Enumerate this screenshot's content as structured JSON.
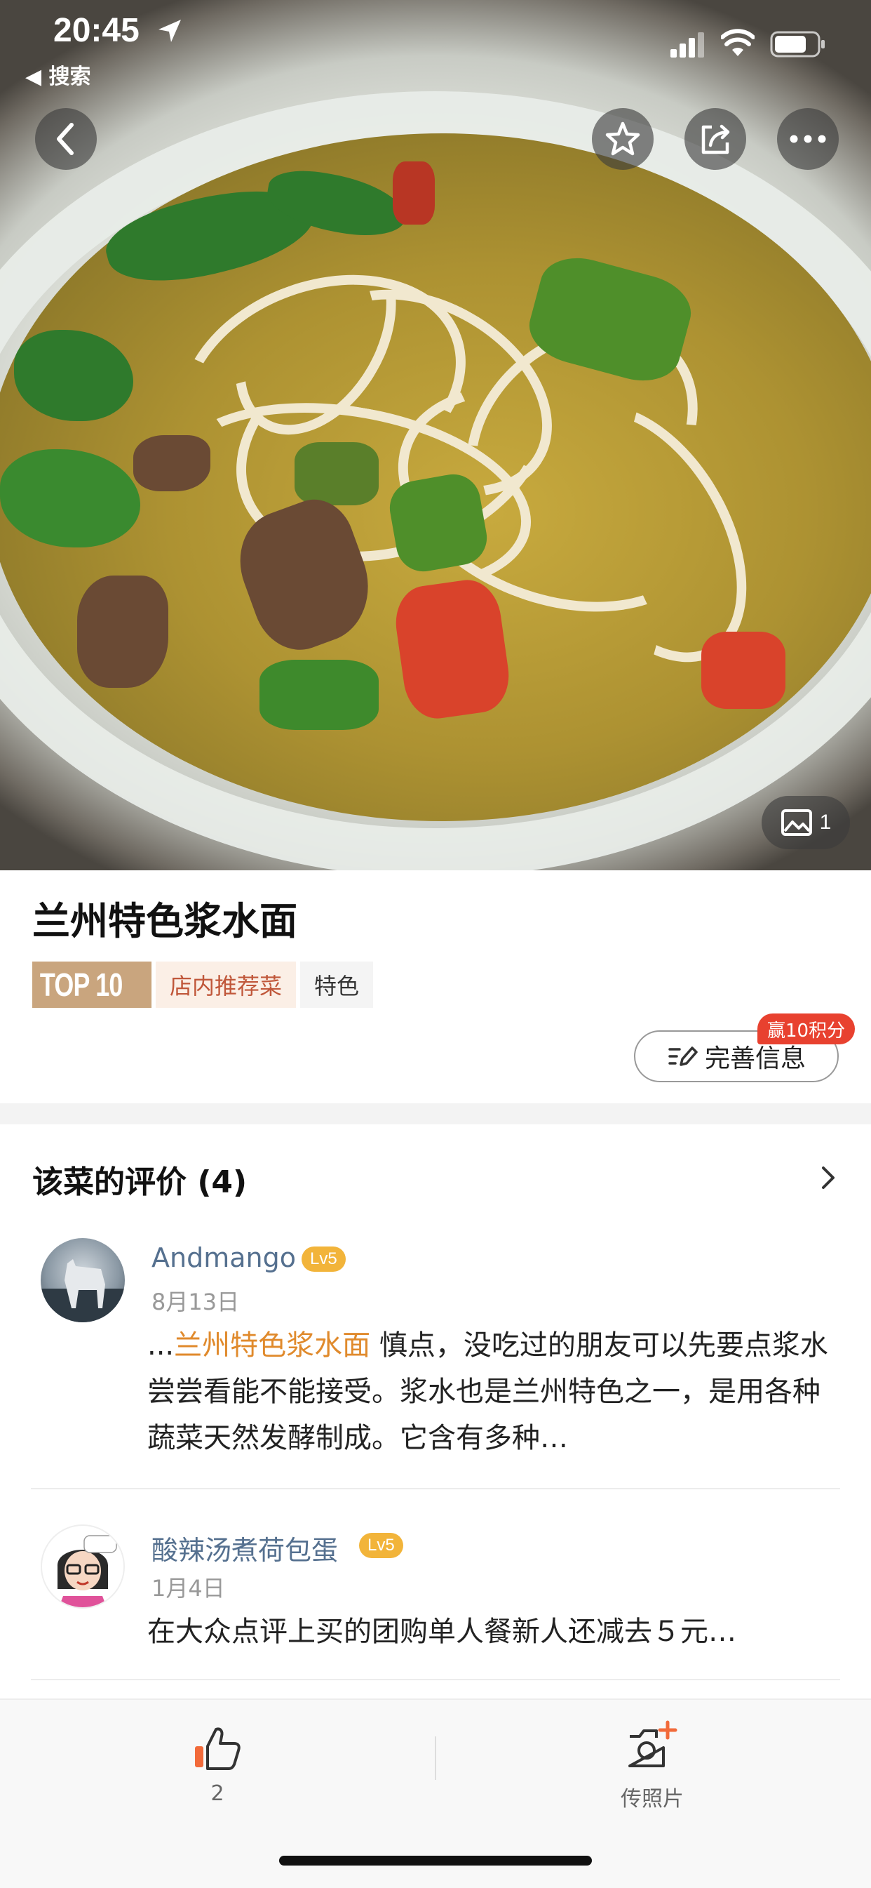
{
  "status_bar": {
    "time": "20:45",
    "back_app": "◀ 搜索"
  },
  "hero": {
    "photo_count": "1"
  },
  "dish": {
    "title": "兰州特色浆水面",
    "rank_badge": "TOP 10",
    "rank_label": "店内推荐菜",
    "tag": "特色",
    "improve_label": "完善信息",
    "reward_badge": "赢10积分"
  },
  "reviews": {
    "title": "该菜的评价 (4)",
    "items": [
      {
        "user": "Andmango",
        "level": "Lv5",
        "date": "8月13日",
        "prefix": "...",
        "highlight": "兰州特色浆水面",
        "text": " 慎点，没吃过的朋友可以先要点浆水尝尝看能不能接受。浆水也是兰州特色之一，是用各种蔬菜天然发酵制成。它含有多种…"
      },
      {
        "user": "酸辣汤煮荷包蛋",
        "level": "Lv5",
        "date": "1月4日",
        "text": "在大众点评上买的团购单人餐新人还减去５元…"
      }
    ]
  },
  "bottom_bar": {
    "like_count": "2",
    "upload_label": "传照片"
  },
  "colors": {
    "highlight": "#e08a2c",
    "level_badge": "#f2b43a",
    "reward_badge": "#e8412f",
    "rank_badge": "#c9a57e",
    "username": "#55708f"
  }
}
